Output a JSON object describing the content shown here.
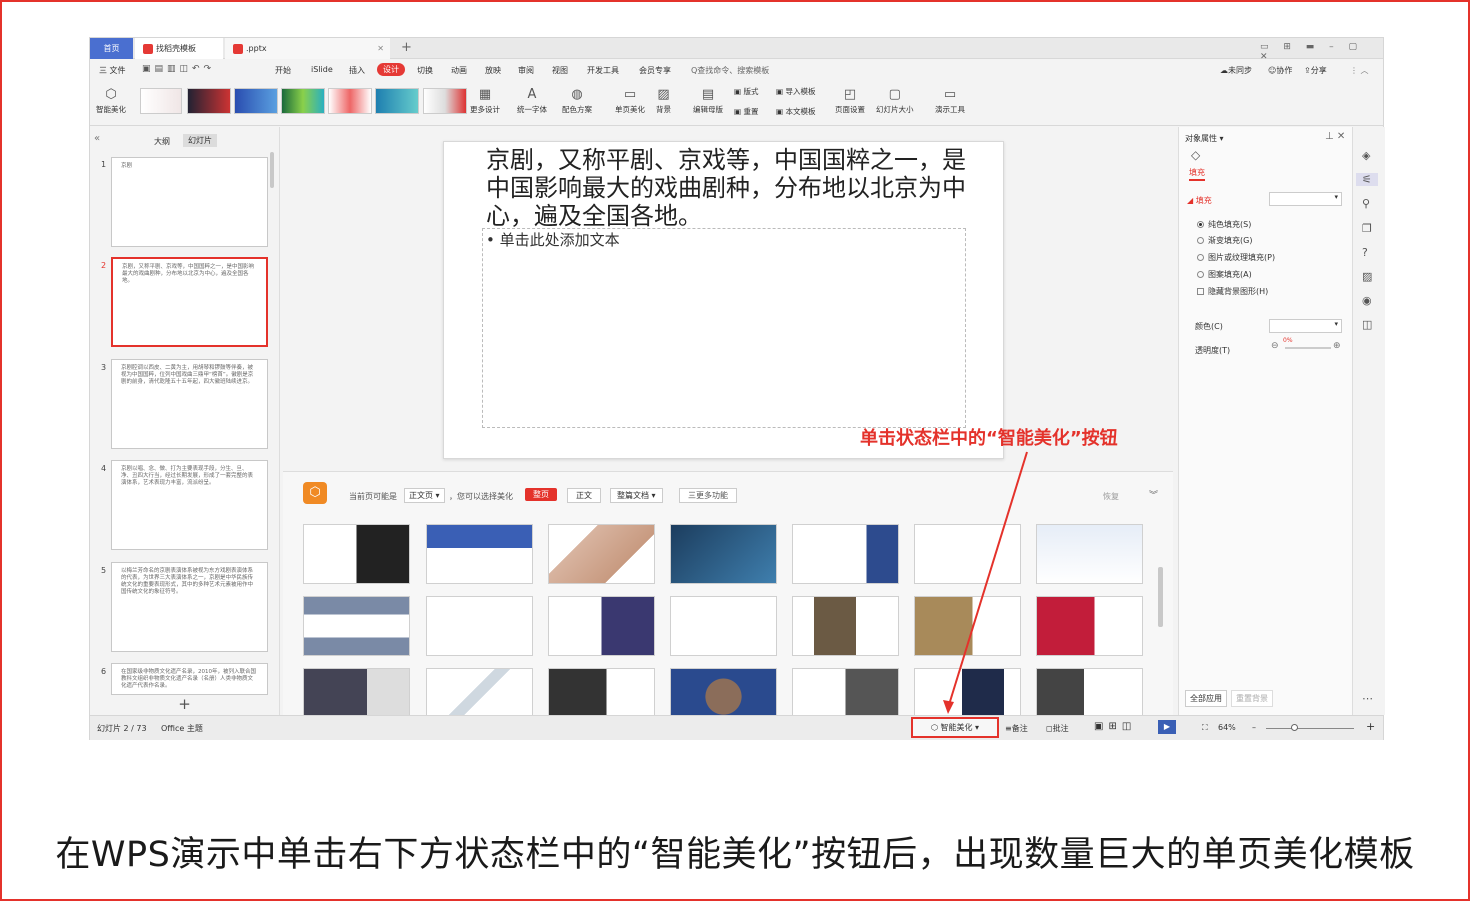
{
  "tabs": {
    "home": "首页",
    "template": "找稻壳模板",
    "file": ".pptx"
  },
  "menu": {
    "file": "三 文件",
    "items": [
      "开始",
      "iSlide",
      "插入",
      "设计",
      "切换",
      "动画",
      "放映",
      "审阅",
      "视图",
      "开发工具",
      "会员专享"
    ],
    "active": "设计",
    "search": "Q查找命令、搜索模板",
    "sync": "未同步",
    "collab": "协作",
    "share": "分享"
  },
  "ribbon": {
    "smart": "智能美化",
    "more_design": "更多设计",
    "unify_font": "统一字体",
    "color_scheme": "配色方案",
    "single_page": "单页美化",
    "background": "背景",
    "edit_master": "编辑母版",
    "layout": "版式",
    "import_template": "导入模板",
    "reset": "重置",
    "text_template": "本文模板",
    "page_setup": "页面设置",
    "slide_size": "幻灯片大小",
    "present_tools": "演示工具"
  },
  "left_panel": {
    "tab_outline": "大纲",
    "tab_slides": "幻灯片",
    "slides": [
      {
        "num": "1",
        "text": "京剧"
      },
      {
        "num": "2",
        "text": "京剧，又称平剧、京戏等，中国国粹之一，是中国影响最大的戏曲剧种，分布地以北京为中心，遍及全国各地。"
      },
      {
        "num": "3",
        "text": "京剧腔调以西皮、二黄为主，用胡琴和锣鼓等伴奏，被视为中国国粹，位列中国戏曲三鼎甲“榜首”。徽剧是京剧的前身，清代乾隆五十五年起，四大徽班陆续进京。"
      },
      {
        "num": "4",
        "text": "京剧以唱、念、做、打为主要表现手段，分生、旦、净、丑四大行当，经过长期发展，形成了一套完整的表演体系，艺术表现力丰富，流派纷呈。"
      },
      {
        "num": "5",
        "text": "以梅兰芳命名的京剧表演体系被视为东方戏剧表演体系的代表，为世界三大表演体系之一，京剧是中华民族传统文化的重要表现形式，其中的多种艺术元素被用作中国传统文化的象征符号。"
      },
      {
        "num": "6",
        "text": "在国家级非物质文化遗产名录，2010年，被列入联合国教科文组织非物质文化遗产名录（名册）人类非物质文化遗产代表作名录。"
      }
    ],
    "add": "+"
  },
  "slide": {
    "title": "京剧，又称平剧、京戏等，中国国粹之一，是中国影响最大的戏曲剧种，分布地以北京为中心，遍及全国各地。",
    "bullet": "• 单击此处添加文本"
  },
  "beautify": {
    "current_page": "当前页可能是",
    "page_type": "正文页 ▾",
    "choose": "，您可以选择美化",
    "btn_whole": "整页",
    "btn_text": "正文",
    "btn_doc": "整篇文档 ▾",
    "more": "三更多功能",
    "restore": "恢复"
  },
  "right_panel": {
    "title": "对象属性 ▾",
    "fill_tab": "填充",
    "fill_section": "填充",
    "options": [
      "纯色填充(S)",
      "渐变填充(G)",
      "图片或纹理填充(P)",
      "图案填充(A)"
    ],
    "hide_bg": "隐藏背景图形(H)",
    "color": "颜色(C)",
    "transparency": "透明度(T)",
    "transparency_value": "0%",
    "apply_all": "全部应用",
    "reset_bg": "重置背景"
  },
  "status": {
    "slide_count": "幻灯片 2 / 73",
    "theme": "Office 主题",
    "smart": "智能美化",
    "notes": "备注",
    "comment": "批注",
    "zoom": "64%"
  },
  "annotation": "单击状态栏中的“智能美化”按钮",
  "caption": "在WPS演示中单击右下方状态栏中的“智能美化”按钮后，出现数量巨大的单页美化模板",
  "colors": {
    "accent": "#e4322b",
    "wps_blue": "#4a6fd0"
  }
}
